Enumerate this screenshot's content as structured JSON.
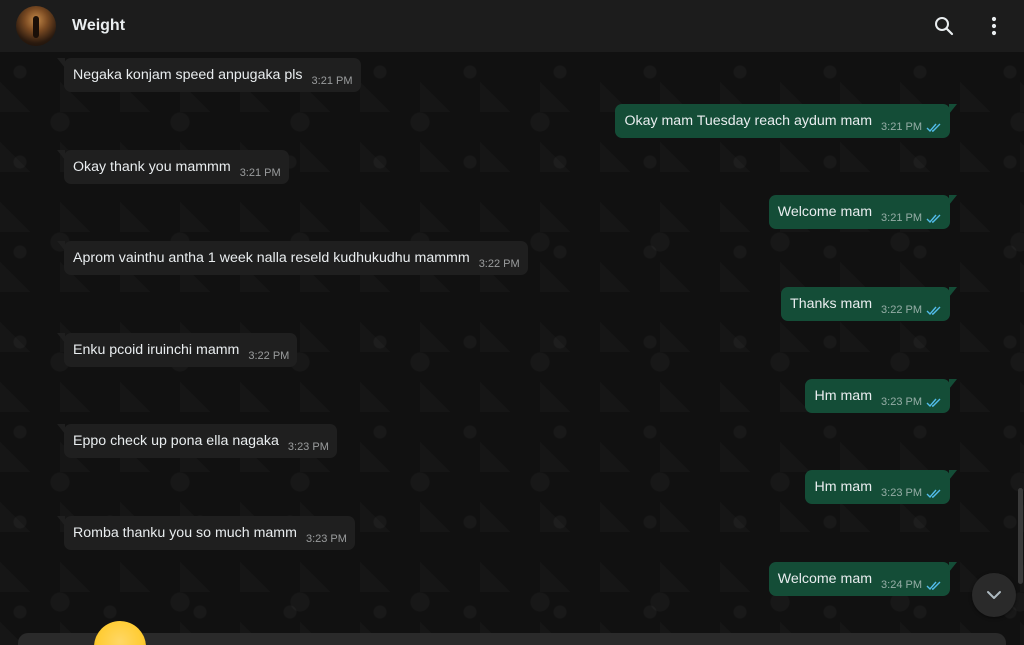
{
  "header": {
    "title": "Weight",
    "icons": [
      "search-icon",
      "more-vertical-icon"
    ]
  },
  "messages": [
    {
      "dir": "in",
      "text": "Negaka konjam speed anpugaka pls",
      "time": "3:21 PM"
    },
    {
      "dir": "out",
      "text": "Okay mam Tuesday reach aydum mam",
      "time": "3:21 PM",
      "status": "read"
    },
    {
      "dir": "in",
      "text": "Okay thank you mammm",
      "time": "3:21 PM"
    },
    {
      "dir": "out",
      "text": "Welcome mam",
      "time": "3:21 PM",
      "status": "read"
    },
    {
      "dir": "in",
      "text": "Aprom vainthu antha 1 week nalla reseld kudhukudhu mammm",
      "time": "3:22 PM"
    },
    {
      "dir": "out",
      "text": "Thanks mam",
      "time": "3:22 PM",
      "status": "read"
    },
    {
      "dir": "in",
      "text": "Enku pcoid iruinchi mamm",
      "time": "3:22 PM"
    },
    {
      "dir": "out",
      "text": "Hm mam",
      "time": "3:23 PM",
      "status": "read"
    },
    {
      "dir": "in",
      "text": "Eppo check up pona ella nagaka",
      "time": "3:23 PM"
    },
    {
      "dir": "out",
      "text": "Hm mam",
      "time": "3:23 PM",
      "status": "read"
    },
    {
      "dir": "in",
      "text": "Romba thanku you so much mamm",
      "time": "3:23 PM"
    },
    {
      "dir": "out",
      "text": "Welcome mam",
      "time": "3:24 PM",
      "status": "read"
    }
  ],
  "colors": {
    "incoming_bubble": "#1f1f1f",
    "outgoing_bubble": "#144d37",
    "read_tick": "#53bdeb"
  }
}
